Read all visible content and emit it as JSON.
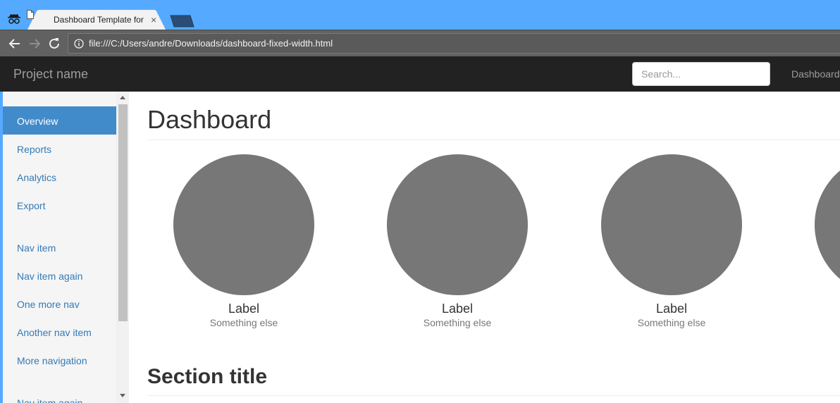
{
  "browser": {
    "tab_title": "Dashboard Template for Bootstrap",
    "close_glyph": "×",
    "url": "file:///C:/Users/andre/Downloads/dashboard-fixed-width.html"
  },
  "navbar": {
    "brand": "Project name",
    "search_placeholder": "Search...",
    "links": [
      "Dashboard"
    ]
  },
  "sidebar": {
    "groups": [
      [
        "Overview",
        "Reports",
        "Analytics",
        "Export"
      ],
      [
        "Nav item",
        "Nav item again",
        "One more nav",
        "Another nav item",
        "More navigation"
      ],
      [
        "Nav item again"
      ]
    ],
    "active_item": "Overview"
  },
  "main": {
    "page_title": "Dashboard",
    "placeholders": [
      {
        "label": "Label",
        "sub": "Something else"
      },
      {
        "label": "Label",
        "sub": "Something else"
      },
      {
        "label": "Label",
        "sub": "Something else"
      },
      {
        "label": "",
        "sub": ""
      }
    ],
    "section_title": "Section title"
  },
  "colors": {
    "chrome_frame": "#55aaff",
    "navbar_bg": "#222222",
    "active_nav": "#428bca",
    "link": "#337ab7",
    "placeholder_circle": "#777777"
  },
  "icons": [
    "incognito-icon",
    "page-icon",
    "close-icon",
    "back-arrow-icon",
    "forward-arrow-icon",
    "reload-icon",
    "info-icon"
  ]
}
